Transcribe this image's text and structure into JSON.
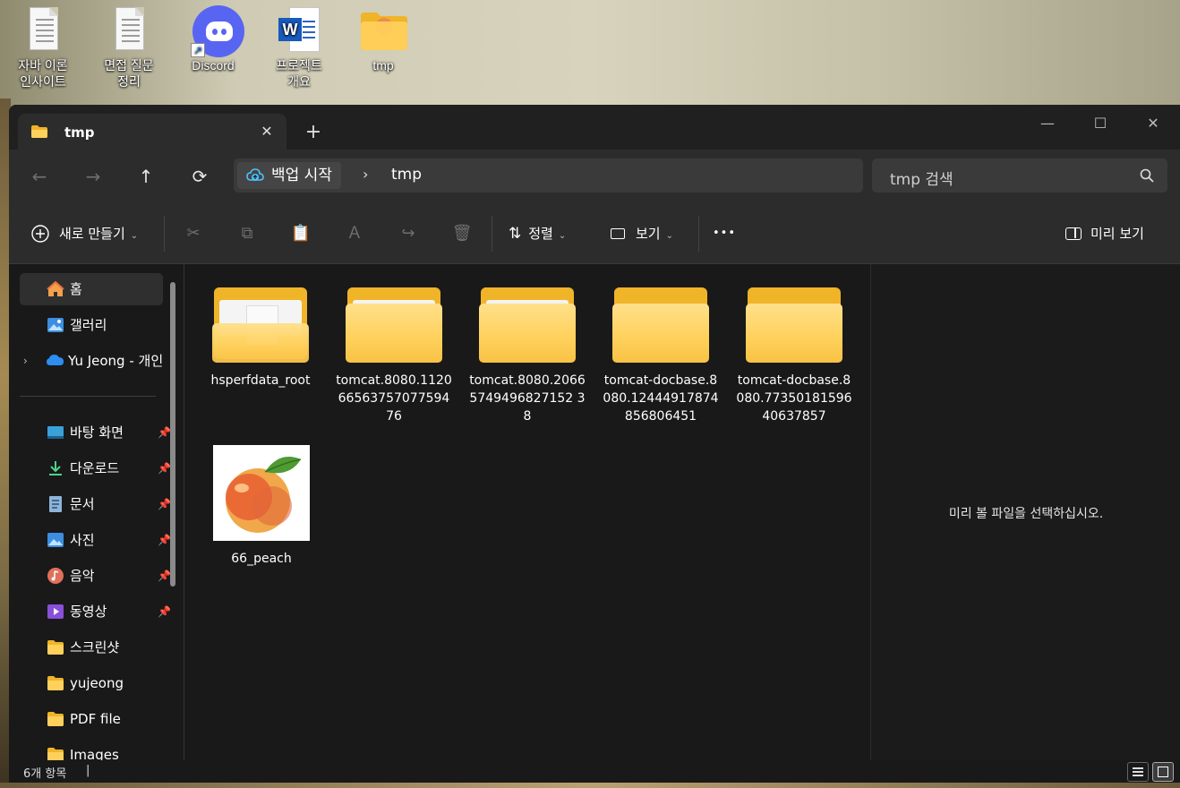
{
  "desktop": {
    "icons": [
      {
        "label": "자바 이론\n인사이트",
        "icon": "text-document-icon"
      },
      {
        "label": "면접 질문\n정리",
        "icon": "text-document-icon"
      },
      {
        "label": "Discord",
        "icon": "discord-icon"
      },
      {
        "label": "프로젝트\n개요",
        "icon": "word-document-icon"
      },
      {
        "label": "tmp",
        "icon": "folder-icon"
      }
    ]
  },
  "window": {
    "tab_title": "tmp",
    "new_tab": "+",
    "controls": {
      "minimize": "—",
      "maximize": "☐",
      "close": "✕"
    }
  },
  "navigation": {
    "back": "←",
    "forward": "→",
    "up": "↑",
    "refresh": "⟳",
    "address_root": "백업 시작",
    "address_separator": "›",
    "address_current": "tmp",
    "search_placeholder": "tmp 검색"
  },
  "toolbar": {
    "new_label": "새로 만들기",
    "sort_label": "정렬",
    "view_label": "보기",
    "more": "•••",
    "preview_label": "미리 보기"
  },
  "sidebar": {
    "items": [
      {
        "label": "홈",
        "icon": "home-icon"
      },
      {
        "label": "갤러리",
        "icon": "gallery-icon"
      },
      {
        "label": "Yu Jeong - 개인",
        "icon": "onedrive-icon"
      },
      {
        "label": "바탕 화면",
        "icon": "desktop-icon",
        "pinned": true
      },
      {
        "label": "다운로드",
        "icon": "download-icon",
        "pinned": true
      },
      {
        "label": "문서",
        "icon": "documents-icon",
        "pinned": true
      },
      {
        "label": "사진",
        "icon": "pictures-icon",
        "pinned": true
      },
      {
        "label": "음악",
        "icon": "music-icon",
        "pinned": true
      },
      {
        "label": "동영상",
        "icon": "videos-icon",
        "pinned": true
      },
      {
        "label": "스크린샷",
        "icon": "folder-icon"
      },
      {
        "label": "yujeong",
        "icon": "folder-icon"
      },
      {
        "label": "PDF file",
        "icon": "folder-icon"
      },
      {
        "label": "Images",
        "icon": "folder-icon"
      }
    ]
  },
  "files": [
    {
      "name": "hsperfdata_root",
      "type": "folder-with-file"
    },
    {
      "name": "tomcat.8080.11206656375707759476",
      "type": "folder"
    },
    {
      "name": "tomcat.8080.20665749496827152 38",
      "type": "folder"
    },
    {
      "name": "tomcat-docbase.8080.12444917874856806451",
      "type": "folder"
    },
    {
      "name": "tomcat-docbase.8080.7735018159640637857",
      "type": "folder"
    },
    {
      "name": "66_peach",
      "type": "image"
    }
  ],
  "preview": {
    "empty_text": "미리 볼 파일을 선택하십시오."
  },
  "status": {
    "count_text": "6개 항목",
    "cursor": "|"
  },
  "colors": {
    "folder_yellow": "#ffd05b",
    "window_bg": "#191919",
    "toolbar_bg": "#2c2c2c",
    "discord_blue": "#5865f2",
    "word_blue": "#185abd"
  }
}
